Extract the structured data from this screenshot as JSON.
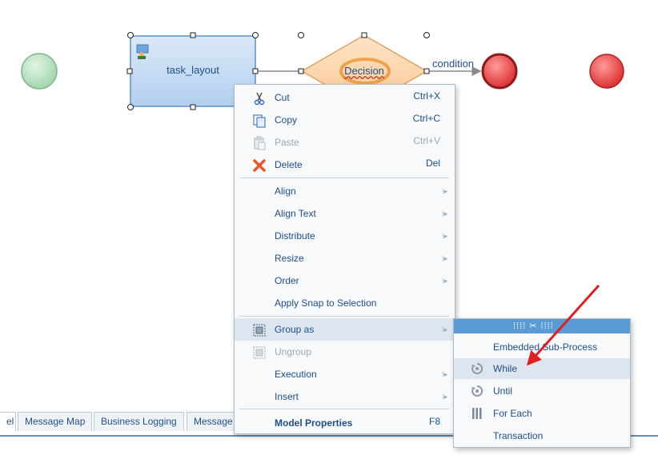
{
  "diagram": {
    "task_label": "task_layout",
    "decision_label": "Decision",
    "condition_label": "condition"
  },
  "tabs": [
    {
      "label": "el"
    },
    {
      "label": "Message Map"
    },
    {
      "label": "Business Logging"
    },
    {
      "label": "Message"
    }
  ],
  "context_menu": {
    "items": [
      {
        "label": "Cut",
        "shortcut": "Ctrl+X",
        "icon": "scissors-icon",
        "enabled": true
      },
      {
        "label": "Copy",
        "shortcut": "Ctrl+C",
        "icon": "copy-icon",
        "enabled": true
      },
      {
        "label": "Paste",
        "shortcut": "Ctrl+V",
        "icon": "paste-icon",
        "enabled": false
      },
      {
        "label": "Delete",
        "shortcut": "Del",
        "icon": "delete-x-icon",
        "enabled": true
      },
      {
        "label": "Align",
        "submenu": true
      },
      {
        "label": "Align Text",
        "submenu": true
      },
      {
        "label": "Distribute",
        "submenu": true
      },
      {
        "label": "Resize",
        "submenu": true
      },
      {
        "label": "Order",
        "submenu": true
      },
      {
        "label": "Apply Snap to Selection"
      },
      {
        "label": "Group as",
        "submenu": true,
        "icon": "group-icon",
        "highlighted": true
      },
      {
        "label": "Ungroup",
        "icon": "ungroup-icon",
        "enabled": false
      },
      {
        "label": "Execution",
        "submenu": true
      },
      {
        "label": "Insert",
        "submenu": true
      },
      {
        "label": "Model Properties",
        "shortcut": "F8"
      }
    ]
  },
  "group_submenu": {
    "items": [
      {
        "label": "Embedded Sub-Process"
      },
      {
        "label": "While",
        "icon": "loop-icon",
        "highlighted": true
      },
      {
        "label": "Until",
        "icon": "loop-icon"
      },
      {
        "label": "For Each",
        "icon": "foreach-icon"
      },
      {
        "label": "Transaction"
      }
    ]
  },
  "colors": {
    "accent": "#5b9bd5",
    "start_event": "#a8dbb0",
    "end_event": "#e84848",
    "decision": "#fbd3a8",
    "task": "#c6dcf2",
    "annotation_arrow": "#e02020"
  }
}
